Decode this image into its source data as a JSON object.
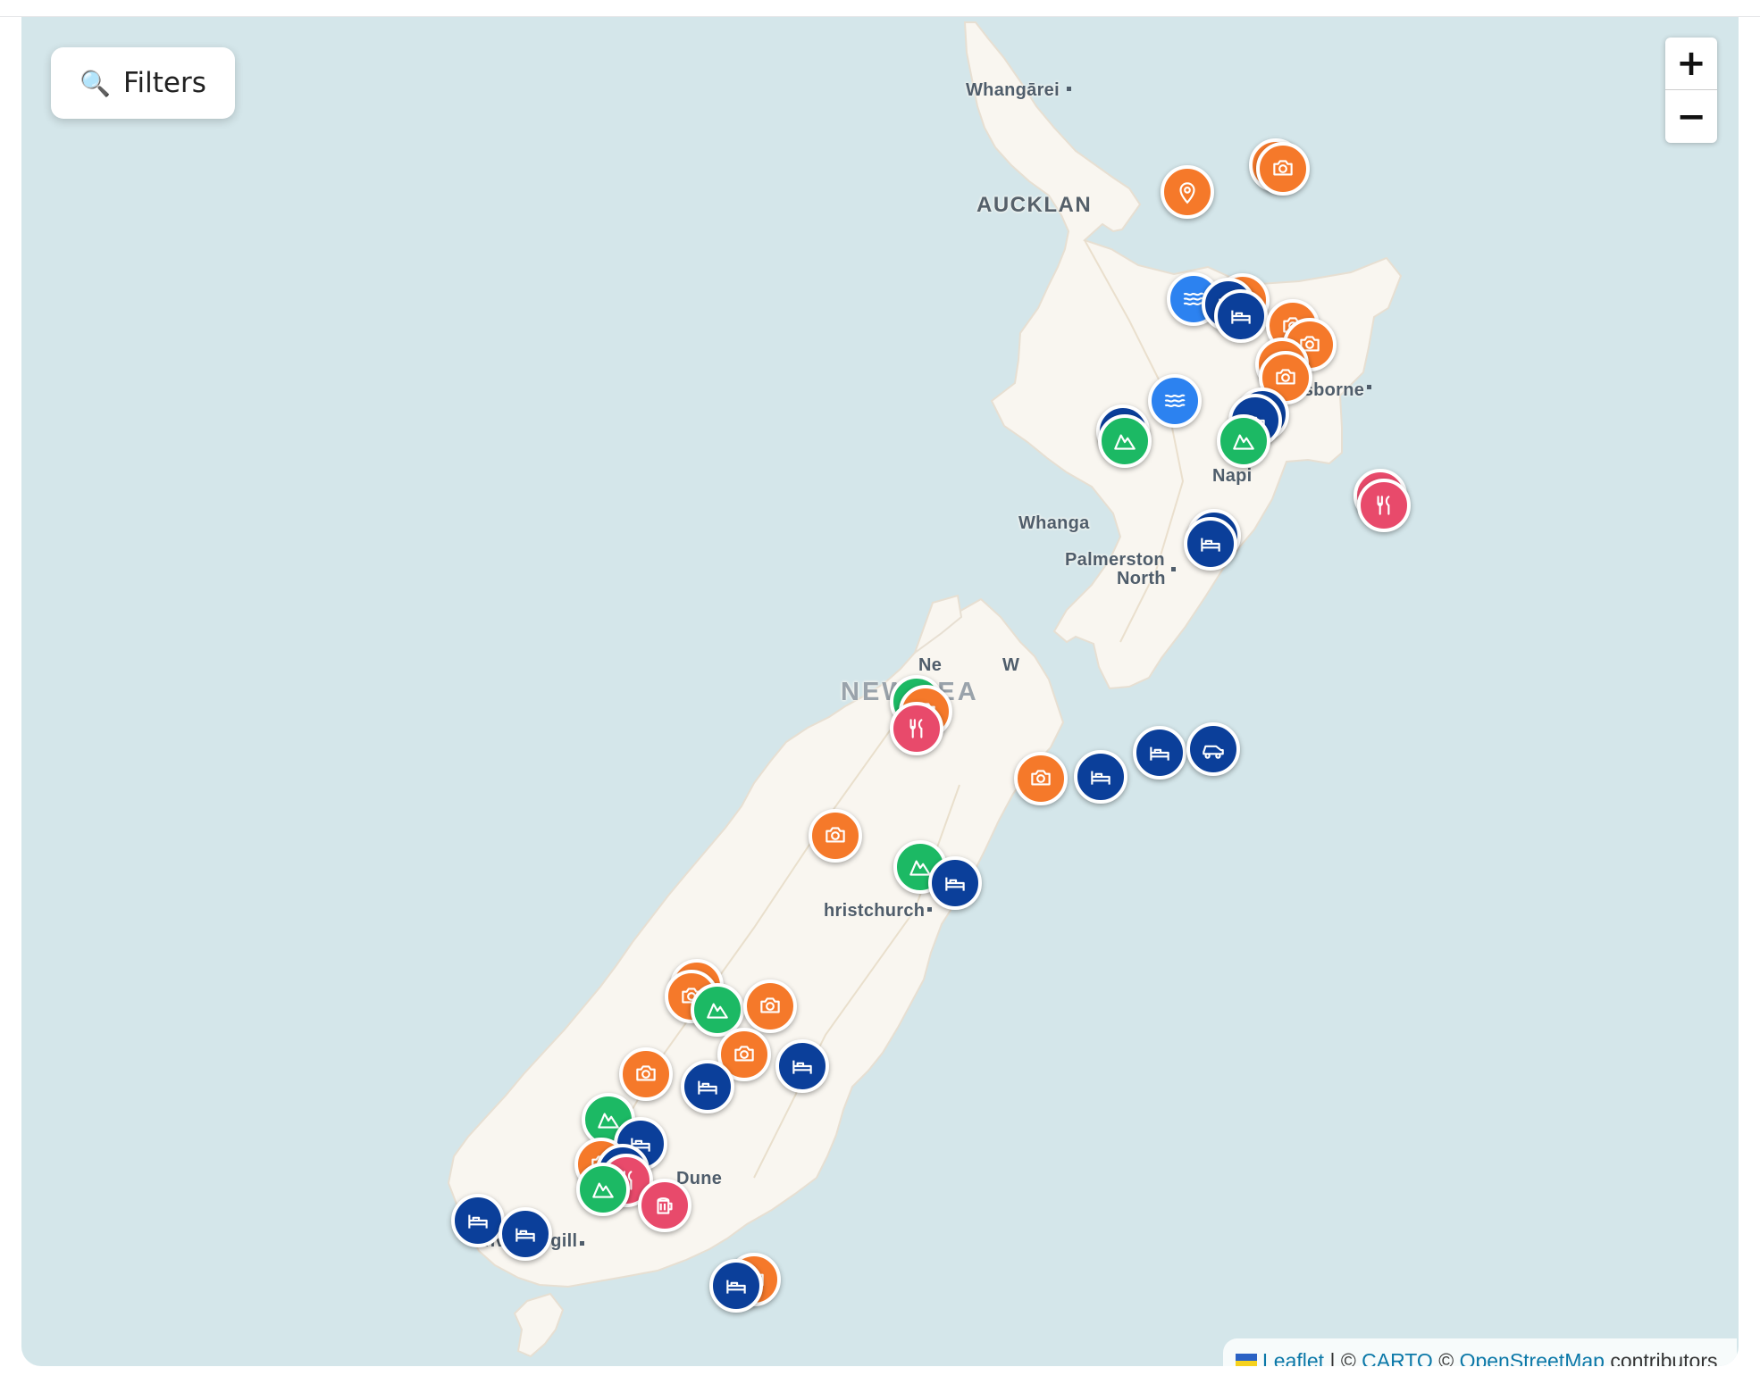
{
  "filter_button": {
    "icon": "search-icon",
    "label": "Filters"
  },
  "zoom": {
    "in_label": "+",
    "out_label": "−"
  },
  "attribution": {
    "flag": "ukraine-flag-icon",
    "leaflet": "Leaflet",
    "sep1": " | © ",
    "carto": "CARTO",
    "sep2": " © ",
    "osm": "OpenStreetMap",
    "tail": " contributors"
  },
  "places": {
    "whangarei": "Whangārei",
    "auckland": "AUCKLAN",
    "gisborne": "Gisborne",
    "napier": "Napi",
    "whanganui": "Whanga",
    "palmerston": "Palmerston",
    "palmerston2": "North",
    "nelson": "Ne",
    "wellington": "W",
    "country": "NEW ZEA",
    "christchurch": "hristchurch",
    "dunedin": "Dune",
    "invercargill": "Invercargill"
  },
  "category_colors": {
    "sightseeing": "#f5792a",
    "location": "#f5792a",
    "accommodation": "#0b3f9a",
    "hiking": "#1cb964",
    "hot-springs": "#2c82f0",
    "food": "#e84a6b",
    "bar": "#e84a6b",
    "transport": "#0b3f9a"
  },
  "category_icons": {
    "sightseeing": "camera-icon",
    "location": "map-pin-icon",
    "accommodation": "bed-icon",
    "hiking": "mountain-icon",
    "hot-springs": "waves-icon",
    "food": "utensils-icon",
    "bar": "beer-mug-icon",
    "transport": "car-icon"
  },
  "markers": [
    {
      "cat": "sightseeing",
      "lat": -36.71,
      "lon": 175.76
    },
    {
      "cat": "sightseeing",
      "lat": -36.74,
      "lon": 175.81
    },
    {
      "cat": "location",
      "lat": -36.91,
      "lon": 175.13
    },
    {
      "cat": "hot-springs",
      "lat": -37.71,
      "lon": 175.17
    },
    {
      "cat": "sightseeing",
      "lat": -37.72,
      "lon": 175.52
    },
    {
      "cat": "accommodation",
      "lat": -37.75,
      "lon": 175.42
    },
    {
      "cat": "accommodation",
      "lat": -37.84,
      "lon": 175.51
    },
    {
      "cat": "sightseeing",
      "lat": -37.91,
      "lon": 175.88
    },
    {
      "cat": "sightseeing",
      "lat": -38.05,
      "lon": 176.0
    },
    {
      "cat": "sightseeing",
      "lat": -38.2,
      "lon": 175.8
    },
    {
      "cat": "sightseeing",
      "lat": -38.3,
      "lon": 175.83
    },
    {
      "cat": "hot-springs",
      "lat": -38.47,
      "lon": 175.04
    },
    {
      "cat": "accommodation",
      "lat": -38.57,
      "lon": 175.66
    },
    {
      "cat": "accommodation",
      "lat": -38.62,
      "lon": 175.61
    },
    {
      "cat": "accommodation",
      "lat": -38.7,
      "lon": 174.67
    },
    {
      "cat": "hiking",
      "lat": -38.77,
      "lon": 174.68
    },
    {
      "cat": "hiking",
      "lat": -38.77,
      "lon": 175.53
    },
    {
      "cat": "food",
      "lat": -39.18,
      "lon": 176.5
    },
    {
      "cat": "food",
      "lat": -39.25,
      "lon": 176.53
    },
    {
      "cat": "accommodation",
      "lat": -39.48,
      "lon": 175.32
    },
    {
      "cat": "accommodation",
      "lat": -39.54,
      "lon": 175.29
    },
    {
      "cat": "hiking",
      "lat": -40.72,
      "lon": 173.2
    },
    {
      "cat": "sightseeing",
      "lat": -40.79,
      "lon": 173.26
    },
    {
      "cat": "food",
      "lat": -40.92,
      "lon": 173.2
    },
    {
      "cat": "accommodation",
      "lat": -41.28,
      "lon": 174.51
    },
    {
      "cat": "accommodation",
      "lat": -41.1,
      "lon": 174.93
    },
    {
      "cat": "transport",
      "lat": -41.07,
      "lon": 175.31
    },
    {
      "cat": "sightseeing",
      "lat": -41.29,
      "lon": 174.08
    },
    {
      "cat": "sightseeing",
      "lat": -41.72,
      "lon": 172.62
    },
    {
      "cat": "hiking",
      "lat": -41.95,
      "lon": 173.22
    },
    {
      "cat": "accommodation",
      "lat": -42.07,
      "lon": 173.47
    },
    {
      "cat": "sightseeing",
      "lat": -42.84,
      "lon": 171.63
    },
    {
      "cat": "sightseeing",
      "lat": -42.92,
      "lon": 171.59
    },
    {
      "cat": "hiking",
      "lat": -43.02,
      "lon": 171.78
    },
    {
      "cat": "sightseeing",
      "lat": -42.99,
      "lon": 172.15
    },
    {
      "cat": "sightseeing",
      "lat": -43.35,
      "lon": 171.97
    },
    {
      "cat": "accommodation",
      "lat": -43.44,
      "lon": 172.38
    },
    {
      "cat": "sightseeing",
      "lat": -43.5,
      "lon": 171.27
    },
    {
      "cat": "accommodation",
      "lat": -43.59,
      "lon": 171.71
    },
    {
      "cat": "hiking",
      "lat": -43.84,
      "lon": 171.0
    },
    {
      "cat": "accommodation",
      "lat": -44.02,
      "lon": 171.23
    },
    {
      "cat": "sightseeing",
      "lat": -44.17,
      "lon": 170.95
    },
    {
      "cat": "accommodation",
      "lat": -44.22,
      "lon": 171.1
    },
    {
      "cat": "food",
      "lat": -44.29,
      "lon": 171.13
    },
    {
      "cat": "hiking",
      "lat": -44.36,
      "lon": 170.96
    },
    {
      "cat": "bar",
      "lat": -44.48,
      "lon": 171.4
    },
    {
      "cat": "accommodation",
      "lat": -44.59,
      "lon": 170.07
    },
    {
      "cat": "accommodation",
      "lat": -44.69,
      "lon": 170.41
    },
    {
      "cat": "sightseeing",
      "lat": -45.03,
      "lon": 172.04
    },
    {
      "cat": "accommodation",
      "lat": -45.08,
      "lon": 171.91
    }
  ]
}
